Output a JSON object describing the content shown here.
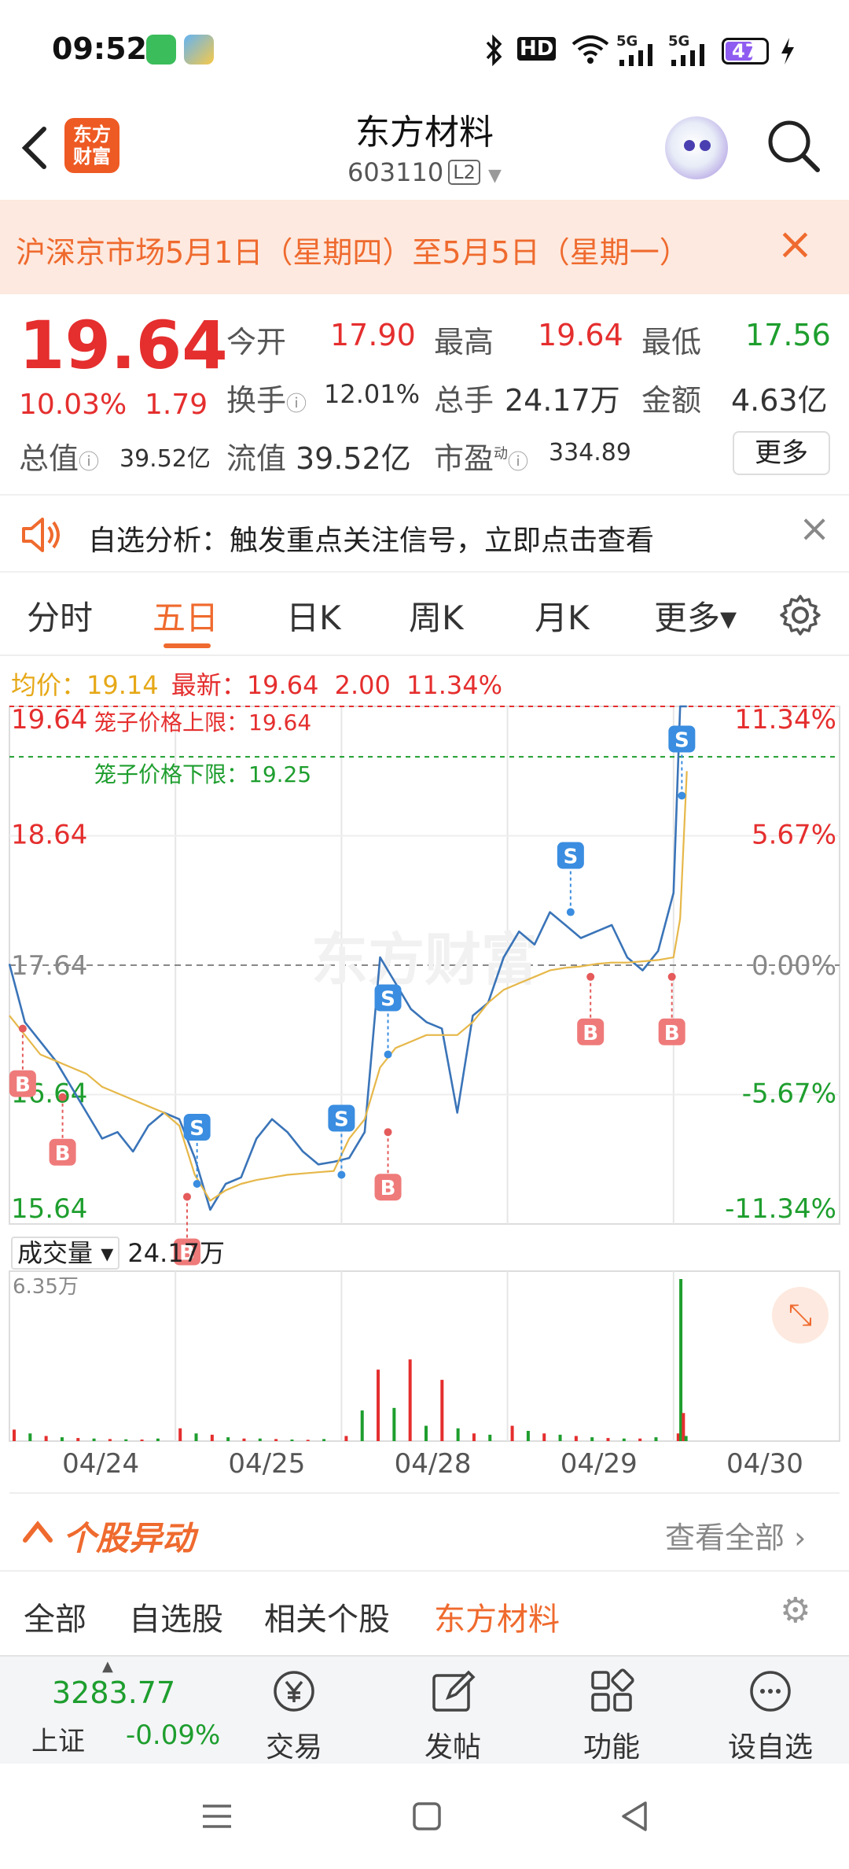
{
  "status_bar": {
    "time": "09:52",
    "icons": [
      "bluetooth-icon",
      "hd-icon",
      "wifi-icon",
      "5g-signal-icon",
      "5g-signal-icon",
      "charging-icon"
    ],
    "hd_label": "HD",
    "net1": "5G",
    "net2": "5G",
    "battery": "47"
  },
  "header": {
    "back_icon": "back-arrow-icon",
    "logo_text": "东方财富",
    "logo_line1": "东方",
    "logo_line2": "财富",
    "title": "东方材料",
    "code": "603110",
    "level": "L2",
    "search_icon": "search-icon",
    "assistant_icon": "robot-avatar-icon"
  },
  "banner": {
    "text": "沪深京市场5月1日（星期四）至5月5日（星期一）",
    "close": "×"
  },
  "quote": {
    "price": "19.64",
    "change_pct": "10.03%",
    "change": "1.79",
    "open_label": "今开",
    "open": "17.90",
    "high_label": "最高",
    "high": "19.64",
    "low_label": "最低",
    "low": "17.56",
    "turnover_label": "换手",
    "turnover": "12.01%",
    "volume_label": "总手",
    "volume": "24.17万",
    "amount_label": "金额",
    "amount": "4.63亿",
    "mktcap_label": "总值",
    "mktcap": "39.52亿",
    "float_label": "流值",
    "float": "39.52亿",
    "pe_label": "市盈",
    "pe_sup": "动",
    "pe": "334.89",
    "more": "更多"
  },
  "notice": {
    "text": "自选分析：触发重点关注信号，立即点击查看",
    "close": "×"
  },
  "tabs": [
    "分时",
    "五日",
    "日K",
    "周K",
    "月K",
    "更多▾"
  ],
  "active_tab": "五日",
  "legend": {
    "avg_label": "均价：",
    "avg": "19.14",
    "last_label": "最新：",
    "last": "19.64",
    "chg": "2.00",
    "chg_pct": "11.34%"
  },
  "chart_data": {
    "type": "line",
    "title": "",
    "xlabel": "",
    "ylabel": "",
    "x_ticks": [
      "04/24",
      "04/25",
      "04/28",
      "04/29",
      "04/30"
    ],
    "ylim": [
      15.64,
      19.64
    ],
    "y_ticks_left": [
      "19.64",
      "18.64",
      "17.64",
      "16.64",
      "15.64"
    ],
    "y_ticks_right": [
      "11.34%",
      "5.67%",
      "0.00%",
      "-5.67%",
      "-11.34%"
    ],
    "ref_price": 17.64,
    "cage_upper_label": "笼子价格上限：19.64",
    "cage_upper": 19.64,
    "cage_lower_label": "笼子价格下限：19.25",
    "cage_lower": 19.25,
    "watermark": "东方财富",
    "series": [
      {
        "color": "#3a74b8",
        "values": [
          17.65,
          17.2,
          17.05,
          16.9,
          16.7,
          16.5,
          16.3,
          16.35,
          16.2,
          16.4,
          16.5,
          16.45,
          16.15,
          15.75,
          15.95,
          16.0,
          16.3,
          16.45,
          16.35,
          16.2,
          16.1,
          16.12,
          16.15,
          16.35,
          17.7,
          17.5,
          17.3,
          17.2,
          17.15,
          16.5,
          17.25,
          17.35,
          17.7,
          17.9,
          17.8,
          18.05,
          17.95,
          17.85,
          17.9,
          17.95,
          17.7,
          17.6,
          17.75,
          18.2,
          19.64,
          19.64
        ]
      },
      {
        "color": "#e6b84a",
        "values": [
          17.25,
          17.1,
          16.95,
          16.9,
          16.85,
          16.8,
          16.7,
          16.65,
          16.6,
          16.55,
          16.5,
          16.4,
          16.02,
          15.82,
          15.9,
          15.95,
          15.98,
          16.0,
          16.02,
          16.03,
          16.04,
          16.05,
          16.3,
          16.45,
          16.85,
          17.0,
          17.05,
          17.1,
          17.1,
          17.1,
          17.2,
          17.35,
          17.45,
          17.5,
          17.55,
          17.6,
          17.62,
          17.63,
          17.65,
          17.66,
          17.66,
          17.67,
          17.68,
          17.7,
          18.0,
          19.14
        ]
      }
    ],
    "signals": [
      {
        "type": "B",
        "day": 0,
        "pos": 0.08,
        "price": 17.15
      },
      {
        "type": "B",
        "day": 0,
        "pos": 0.32,
        "price": 16.62
      },
      {
        "type": "B",
        "day": 1,
        "pos": 0.07,
        "price": 15.85
      },
      {
        "type": "S",
        "day": 1,
        "pos": 0.13,
        "price": 15.95
      },
      {
        "type": "S",
        "day": 2,
        "pos": 0.0,
        "price": 16.02
      },
      {
        "type": "B",
        "day": 2,
        "pos": 0.28,
        "price": 16.35
      },
      {
        "type": "S",
        "day": 2,
        "pos": 0.28,
        "price": 16.95
      },
      {
        "type": "S",
        "day": 3,
        "pos": 0.38,
        "price": 18.05
      },
      {
        "type": "B",
        "day": 3,
        "pos": 0.5,
        "price": 17.55
      },
      {
        "type": "S",
        "day": 4,
        "pos": 0.05,
        "price": 18.95
      },
      {
        "type": "B",
        "day": 3,
        "pos": 0.99,
        "price": 17.55
      }
    ],
    "volume_label": "成交量",
    "volume_total": "24.17万",
    "volume_max_label": "6.35万",
    "volume_unit": "万",
    "volume_bars": [
      {
        "day": 0,
        "values": [
          0.45,
          0.3,
          0.2,
          0.15,
          0.12,
          0.1,
          0.08,
          0.07,
          0.06,
          0.1
        ]
      },
      {
        "day": 1,
        "values": [
          0.5,
          0.3,
          0.25,
          0.15,
          0.1,
          0.1,
          0.08,
          0.06,
          0.05,
          0.08
        ]
      },
      {
        "day": 2,
        "values": [
          0.2,
          1.2,
          2.8,
          1.3,
          3.2,
          0.6,
          2.4,
          0.5,
          0.3,
          0.25
        ]
      },
      {
        "day": 3,
        "values": [
          0.6,
          0.4,
          0.3,
          0.25,
          0.2,
          0.15,
          0.12,
          0.1,
          0.1,
          0.15
        ]
      },
      {
        "day": 4,
        "values": [
          0.3,
          6.35,
          1.1,
          0.2
        ]
      }
    ]
  },
  "movement": {
    "title": "个股异动",
    "more": "查看全部",
    "tabs": [
      "全部",
      "自选股",
      "相关个股",
      "东方材料"
    ],
    "active": "东方材料"
  },
  "bottom": {
    "index_value": "3283.77",
    "index_name": "上证",
    "index_change": "-0.09%",
    "nav": [
      {
        "label": "交易",
        "icon": "trade-yen-icon"
      },
      {
        "label": "发帖",
        "icon": "edit-post-icon"
      },
      {
        "label": "功能",
        "icon": "grid-function-icon"
      },
      {
        "label": "设自选",
        "icon": "add-watchlist-icon"
      }
    ]
  },
  "system_nav": [
    "menu-icon",
    "home-square-icon",
    "back-triangle-icon"
  ]
}
